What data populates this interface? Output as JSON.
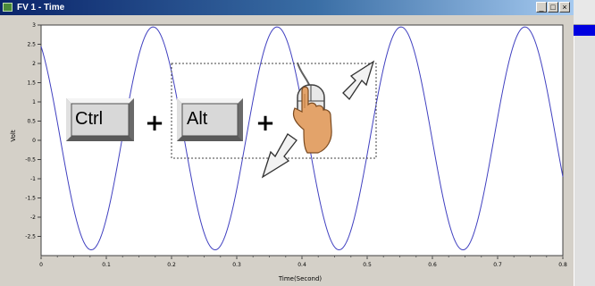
{
  "window": {
    "title": "FV 1 - Time",
    "minimize_glyph": "_",
    "maximize_glyph": "□",
    "close_glyph": "×"
  },
  "overlay": {
    "key1": "Ctrl",
    "key2": "Alt",
    "plus": "+",
    "icons": [
      "keyboard-key-icon",
      "mouse-hand-icon",
      "arrow-up-right-icon",
      "arrow-down-left-icon"
    ]
  },
  "colors": {
    "series": "#4040c0",
    "side_tab": "#0000e0"
  },
  "chart_data": {
    "type": "line",
    "xlabel": "Time(Second)",
    "ylabel": "Volt",
    "xlim": [
      0,
      0.8
    ],
    "ylim": [
      -3,
      3
    ],
    "xticks": [
      0,
      0.1,
      0.2,
      0.3,
      0.4,
      0.5,
      0.6,
      0.7,
      0.8
    ],
    "xtick_labels": [
      "0",
      "0.1",
      "0.2",
      "0.3",
      "0.4",
      "0.5",
      "0.6",
      "0.7",
      "0.8"
    ],
    "yticks": [
      3,
      2.5,
      2,
      1.5,
      1,
      0.5,
      0,
      -0.5,
      -1,
      -1.5,
      -2,
      -2.5
    ],
    "ytick_labels": [
      "3",
      "2.5",
      "2",
      "1.5",
      "1",
      "0.5",
      "0",
      "-0.5",
      "-1",
      "-1.5",
      "-2",
      "-2.5"
    ],
    "series": [
      {
        "color": "#4040c0",
        "amplitude": 2.9,
        "frequency": 5.263,
        "phase": 0.6,
        "offset": 0.05
      }
    ]
  }
}
